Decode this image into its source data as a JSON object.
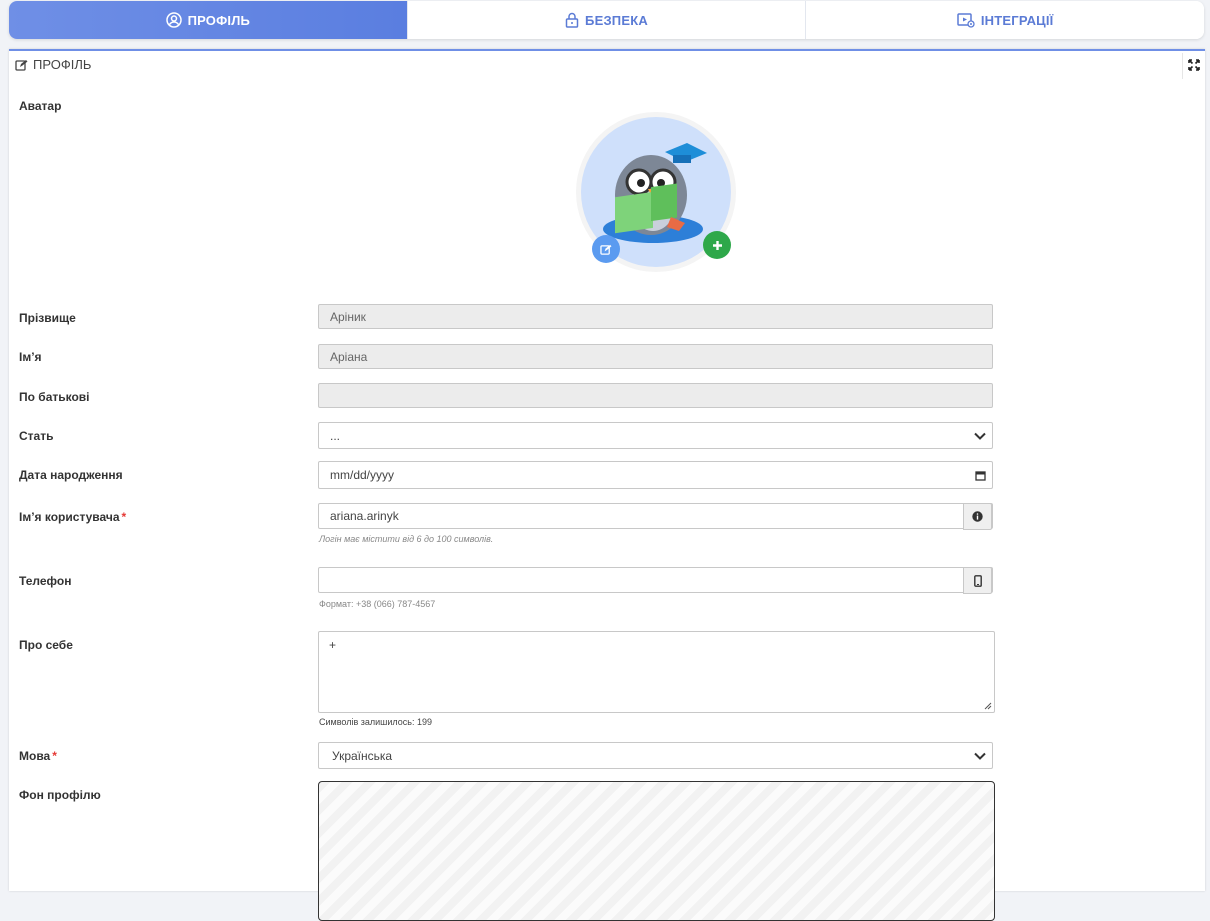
{
  "tabs": [
    {
      "label": "ПРОФІЛЬ",
      "icon": "user-circle-icon",
      "active": true
    },
    {
      "label": "БЕЗПЕКА",
      "icon": "lock-icon",
      "active": false
    },
    {
      "label": "ІНТЕГРАЦІЇ",
      "icon": "integration-icon",
      "active": false
    }
  ],
  "panel": {
    "title": "ПРОФІЛЬ",
    "title_icon": "edit-icon",
    "expand_icon": "expand-icon"
  },
  "form": {
    "avatar_label": "Аватар",
    "surname": {
      "label": "Прізвище",
      "value": "Аріник"
    },
    "name": {
      "label": "Ім’я",
      "value": "Аріана"
    },
    "patronymic": {
      "label": "По батькові",
      "value": ""
    },
    "gender": {
      "label": "Стать",
      "value": "..."
    },
    "birthdate": {
      "label": "Дата народження",
      "placeholder": "mm/dd/yyyy"
    },
    "username": {
      "label": "Ім’я користувача",
      "required": "*",
      "value": "ariana.arinyk",
      "help": "Логін має містити від 6 до 100 символів."
    },
    "phone": {
      "label": "Телефон",
      "value": "",
      "help": "Формат: +38 (066) 787-4567"
    },
    "about": {
      "label": "Про себе",
      "value": "+",
      "counter": "Символів залишилось: 199"
    },
    "language": {
      "label": "Мова",
      "required": "*",
      "value": "Українська"
    },
    "background": {
      "label": "Фон профілю"
    }
  },
  "colors": {
    "accent": "#6f8fe6",
    "edit_btn": "#5b9bf0",
    "add_btn": "#2ea84a",
    "required": "#e53935"
  }
}
